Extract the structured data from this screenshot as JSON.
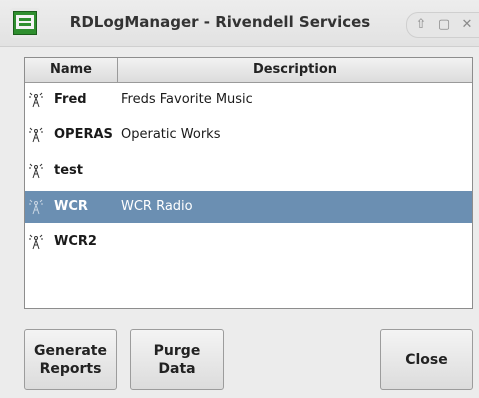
{
  "window": {
    "title": "RDLogManager - Rivendell Services",
    "controls": [
      "up-icon",
      "maximize-icon",
      "close-icon"
    ]
  },
  "table": {
    "columns": [
      "Name",
      "Description"
    ],
    "rows": [
      {
        "name": "Fred",
        "description": "Freds Favorite Music",
        "icon": "service-icon",
        "selected": false
      },
      {
        "name": "OPERAS",
        "description": "Operatic Works",
        "icon": "service-icon",
        "selected": false
      },
      {
        "name": "test",
        "description": "",
        "icon": "service-icon",
        "selected": false
      },
      {
        "name": "WCR",
        "description": "WCR Radio",
        "icon": "service-icon",
        "selected": true
      },
      {
        "name": "WCR2",
        "description": "",
        "icon": "service-icon",
        "selected": false
      }
    ]
  },
  "buttons": {
    "generate": "Generate\nReports",
    "purge": "Purge\nData",
    "close": "Close"
  },
  "colors": {
    "selection": "#6b8fb2",
    "app_icon": "#2f8f2f"
  }
}
